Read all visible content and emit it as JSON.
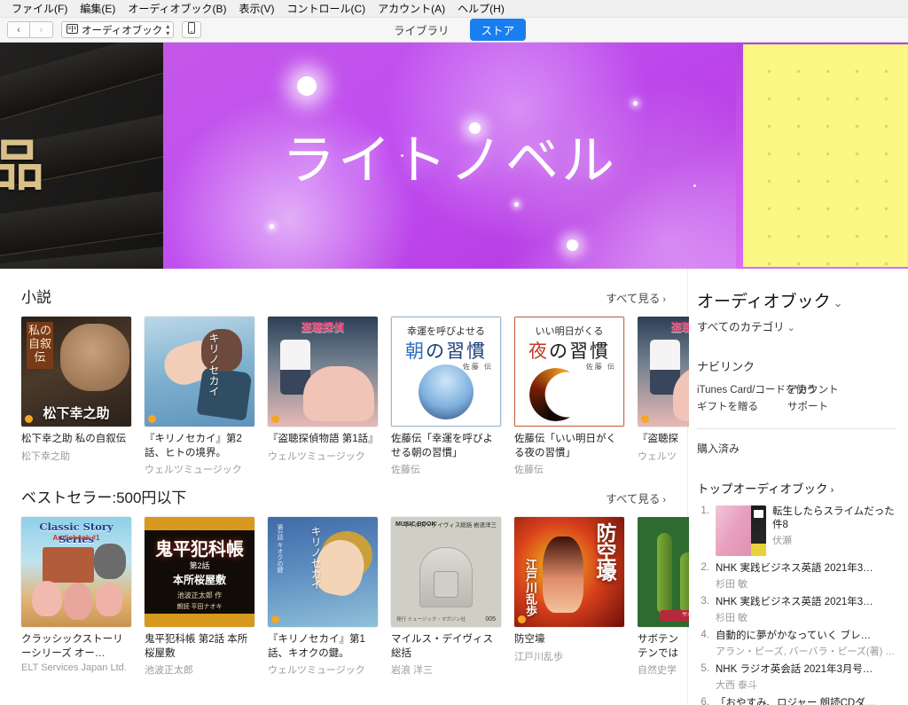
{
  "menubar": [
    {
      "label": "ファイル(F)"
    },
    {
      "label": "編集(E)"
    },
    {
      "label": "オーディオブック(B)"
    },
    {
      "label": "表示(V)"
    },
    {
      "label": "コントロール(C)"
    },
    {
      "label": "アカウント(A)"
    },
    {
      "label": "ヘルプ(H)"
    }
  ],
  "toolbar": {
    "back": "‹",
    "forward": "›",
    "media_label": "オーディオブック",
    "book_icon": "book-icon",
    "device_icon": "device-icon",
    "tabs": [
      {
        "label": "ライブラリ",
        "active": false
      },
      {
        "label": "ストア",
        "active": true
      }
    ],
    "accent_color": "#1a7ef0"
  },
  "hero": {
    "left_banner": {
      "text": "品",
      "bg_color": "#1b1a19",
      "text_color": "#d9c08a"
    },
    "main_banner": {
      "title": "ライトノベル",
      "bg_color": "#c04ef0",
      "text_color": "#ffffff"
    },
    "right_banner": {
      "bg_color": "#fbf884"
    }
  },
  "shelves": [
    {
      "title": "小説",
      "see_all": "すべて見る",
      "see_all_arrow": "›",
      "items": [
        {
          "title": "松下幸之助 私の自叙伝",
          "artist": "松下幸之助",
          "art": "cv-matsushita"
        },
        {
          "title": "『キリノセカイ』第2話、ヒトの境界。",
          "artist": "ウェルツミュージック",
          "art": "cv-kiri2"
        },
        {
          "title": "『盗聴探偵物語 第1話』",
          "artist": "ウェルツミュージック",
          "art": "cv-tocho"
        },
        {
          "title": "佐藤伝「幸運を呼びよせる朝の習慣」",
          "artist": "佐藤伝",
          "art": "cv-asa"
        },
        {
          "title": "佐藤伝「いい明日がくる夜の習慣」",
          "artist": "佐藤伝",
          "art": "cv-yoru"
        },
        {
          "title": "『盗聴探",
          "artist": "ウェルツ",
          "art": "cv-tocho",
          "clipped": true
        }
      ]
    },
    {
      "title": "ベストセラー:500円以下",
      "see_all": "すべて見る",
      "see_all_arrow": "›",
      "items": [
        {
          "title": "クラッシックストーリーシリーズ オー…",
          "artist": "ELT Services Japan Ltd.",
          "art": "cv-classic"
        },
        {
          "title": "鬼平犯科帳 第2話 本所桜屋敷",
          "artist": "池波正太郎",
          "art": "cv-onihei"
        },
        {
          "title": "『キリノセカイ』第1話、キオクの鍵。",
          "artist": "ウェルツミュージック",
          "art": "cv-kiri1"
        },
        {
          "title": "マイルス・デイヴィス総括",
          "artist": "岩浪 洋三",
          "art": "cv-miles"
        },
        {
          "title": "防空壕",
          "artist": "江戸川乱歩",
          "art": "cv-bouku"
        },
        {
          "title": "サボテン テンでは",
          "artist": "自然史学",
          "art": "cv-cactus",
          "clipped": true
        }
      ]
    }
  ],
  "covers": {
    "matsushita": {
      "title_vertical": "私の自叙伝",
      "name": "松下幸之助"
    },
    "kiri2": {
      "vertical_text": "キリノセカイ"
    },
    "tocho": {
      "logo": "盗聴探偵"
    },
    "asa": {
      "top": "幸運を呼びよせる",
      "big_accent": "朝",
      "big_rest": "の習慣",
      "author": "佐藤 伝"
    },
    "yoru": {
      "top": "いい明日がくる",
      "big_accent": "夜",
      "big_rest": "の習慣",
      "author": "佐藤 伝"
    },
    "classic": {
      "header": "Classic Story Series",
      "sub": "Audiobook #1"
    },
    "onihei": {
      "t1": "鬼平犯科帳",
      "t2": "第2話",
      "t3": "本所桜屋敷",
      "t4": "池波正太郎 作",
      "t5": "朗読 平田ナオキ"
    },
    "kiri1": {
      "vertical_text": "キリノセカイ",
      "vertical_small": "第1話 キオクの鍵"
    },
    "miles": {
      "brand": "MUSIC BOOK",
      "right": "マイルス・デイヴィス総括 岩浪洋三",
      "num": "005",
      "cap": "発行 ミュージック・マガジン社"
    },
    "bouku": {
      "vertical_title": "防空壕",
      "vertical_author": "江戸川乱歩"
    },
    "cactus": {
      "ribbon": "サボテン"
    }
  },
  "aside": {
    "title": "オーディオブック",
    "title_chevron": "⌄",
    "subtitle": "すべてのカテゴリ",
    "subtitle_chevron": "⌄",
    "nav_head": "ナビリンク",
    "nav_links": [
      {
        "left": "iTunes Card/コードを使う",
        "right": "アカウント"
      },
      {
        "left": "ギフトを贈る",
        "right": "サポート"
      }
    ],
    "purchased": "購入済み",
    "top_head": "トップオーディオブック",
    "top_head_arrow": "›",
    "top_items": [
      {
        "rank": "1.",
        "title": "転生したらスライムだった件8",
        "artist": "伏瀬",
        "has_thumb": true
      },
      {
        "rank": "2.",
        "title": "NHK 実践ビジネス英語 2021年3…",
        "artist": "杉田 敏",
        "has_thumb": false
      },
      {
        "rank": "3.",
        "title": "NHK 実践ビジネス英語 2021年3…",
        "artist": "杉田 敏",
        "has_thumb": false
      },
      {
        "rank": "4.",
        "title": "自動的に夢がかなっていく ブレ…",
        "artist": "アラン・ピーズ, バーバラ・ピーズ(著) &…",
        "has_thumb": false
      },
      {
        "rank": "5.",
        "title": "NHK ラジオ英会話 2021年3月号…",
        "artist": "大西 泰斗",
        "has_thumb": false
      },
      {
        "rank": "6.",
        "title": "「おやすみ、ロジャー 朗読CDダ…",
        "artist": "",
        "has_thumb": false
      }
    ]
  }
}
